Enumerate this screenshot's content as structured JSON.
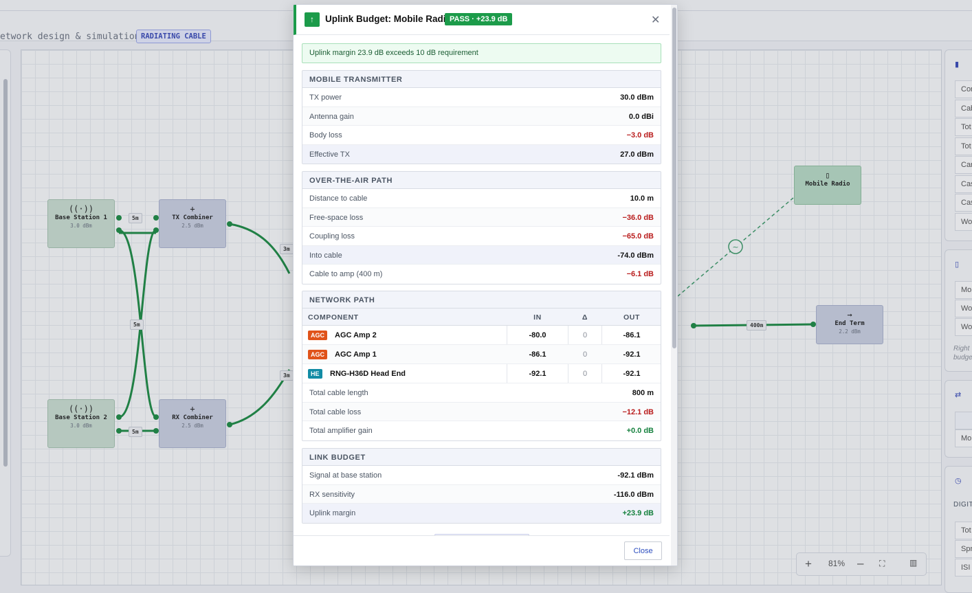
{
  "app": {
    "subtitle": "etwork design & simulation",
    "mode_tag": "RADIATING CABLE"
  },
  "canvas": {
    "nodes": [
      {
        "name": "Base Station 1",
        "sub": "3.0 dBm",
        "icon": "antenna-icon",
        "glyph": "((·))"
      },
      {
        "name": "TX Combiner",
        "sub": "2.5 dBm",
        "icon": "plus-icon",
        "glyph": "+"
      },
      {
        "name": "Base Station 2",
        "sub": "3.0 dBm",
        "icon": "antenna-icon",
        "glyph": "((·))"
      },
      {
        "name": "RX Combiner",
        "sub": "2.5 dBm",
        "icon": "plus-icon",
        "glyph": "+"
      },
      {
        "name": "Mobile Radio",
        "sub": "",
        "icon": "phone-icon",
        "glyph": "▯"
      },
      {
        "name": "End Term",
        "sub": "2.2 dBm",
        "icon": "arrow-right-icon",
        "glyph": "→"
      }
    ],
    "labels": [
      "5m",
      "3m",
      "5m",
      "3m",
      "5m",
      "400m"
    ],
    "wire_color": "#1e8a45"
  },
  "zoom": {
    "level": "81%"
  },
  "right_panel": {
    "rows_1": [
      "Com",
      "Cab",
      "Tot",
      "Tot",
      "Car",
      "Cas",
      "Cas",
      "Wor"
    ],
    "rows_2": [
      "Mob",
      "Wor",
      "Wor"
    ],
    "note_2": [
      "Right",
      "budge"
    ],
    "row_3": "Mob",
    "heading_4": "DIGIT",
    "rows_4": [
      "Tot",
      "Spr",
      "ISI"
    ]
  },
  "modal": {
    "title": "Uplink Budget: Mobile Radio",
    "status": "PASS · +23.9 dB",
    "accent": "#1c9b4a",
    "alert": "Uplink margin 23.9 dB exceeds 10 dB requirement",
    "sections": {
      "mobile_tx": {
        "heading": "MOBILE TRANSMITTER",
        "rows": [
          {
            "k": "TX power",
            "v": "30.0 dBm"
          },
          {
            "k": "Antenna gain",
            "v": "0.0 dBi"
          },
          {
            "k": "Body loss",
            "v": "−3.0 dB"
          },
          {
            "k": "Effective TX",
            "v": "27.0 dBm"
          }
        ]
      },
      "ota": {
        "heading": "OVER-THE-AIR PATH",
        "rows": [
          {
            "k": "Distance to cable",
            "v": "10.0 m"
          },
          {
            "k": "Free-space loss",
            "v": "−36.0 dB"
          },
          {
            "k": "Coupling loss",
            "v": "−65.0 dB"
          },
          {
            "k": "Into cable",
            "v": "-74.0 dBm"
          },
          {
            "k": "Cable to amp (400 m)",
            "v": "−6.1 dB"
          }
        ]
      },
      "network": {
        "heading": "NETWORK PATH",
        "columns": [
          "COMPONENT",
          "IN",
          "Δ",
          "OUT"
        ],
        "components": [
          {
            "badge": "AGC",
            "name": "AGC Amp 2",
            "in": "-80.0",
            "delta": "0",
            "out": "-86.1"
          },
          {
            "badge": "AGC",
            "name": "AGC Amp 1",
            "in": "-86.1",
            "delta": "0",
            "out": "-92.1"
          },
          {
            "badge": "HE",
            "name": "RNG-H36D Head End",
            "in": "-92.1",
            "delta": "0",
            "out": "-92.1"
          }
        ],
        "totals": [
          {
            "k": "Total cable length",
            "v": "800 m"
          },
          {
            "k": "Total cable loss",
            "v": "−12.1 dB"
          },
          {
            "k": "Total amplifier gain",
            "v": "+0.0 dB"
          }
        ]
      },
      "link": {
        "heading": "LINK BUDGET",
        "rows": [
          {
            "k": "Signal at base station",
            "v": "-92.1 dBm"
          },
          {
            "k": "RX sensitivity",
            "v": "-116.0 dBm"
          },
          {
            "k": "Uplink margin",
            "v": "+23.9 dB"
          }
        ]
      }
    },
    "close_label": "Close"
  }
}
